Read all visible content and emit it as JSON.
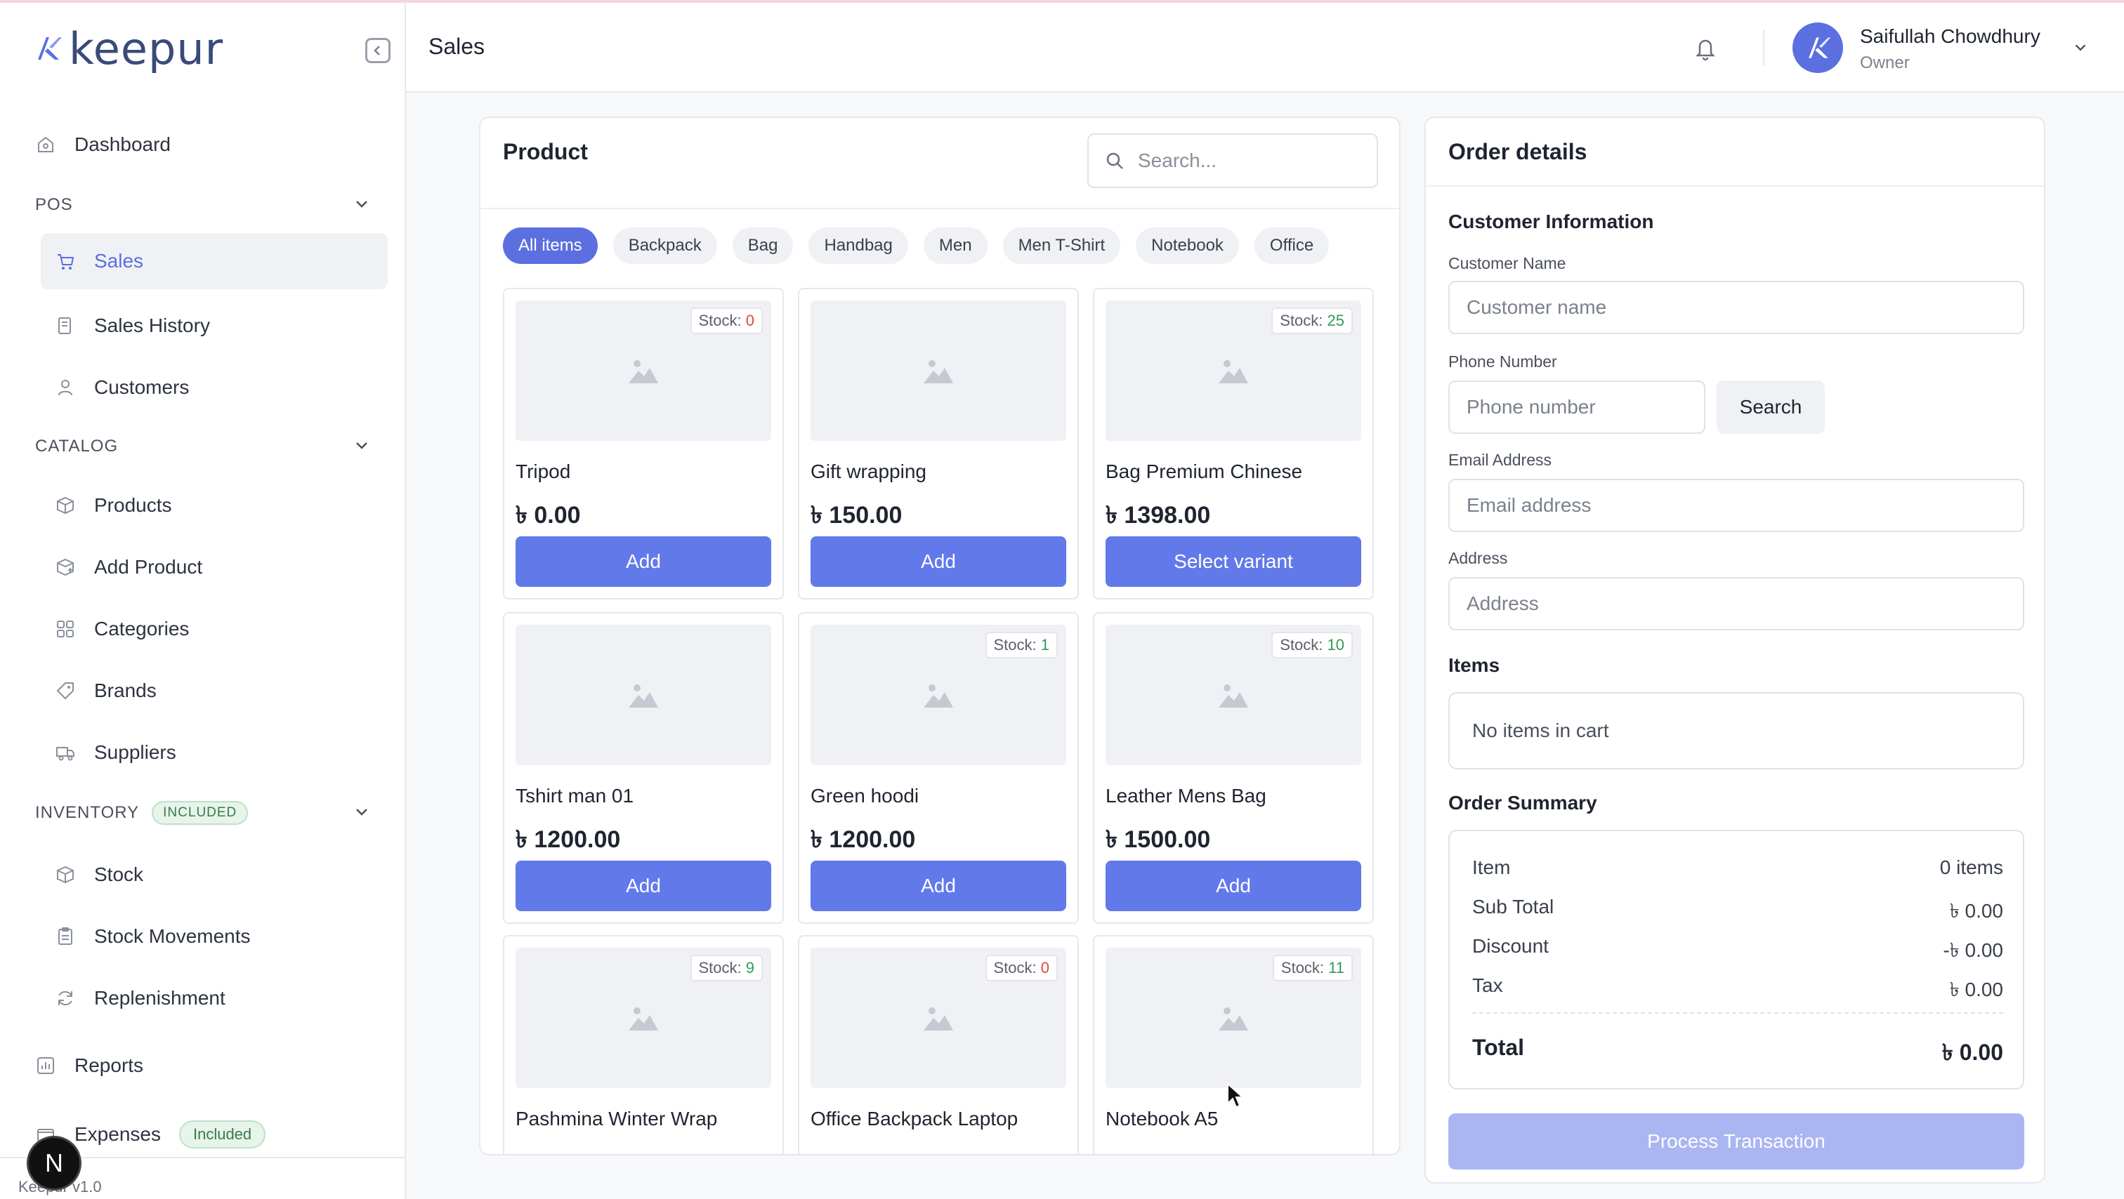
{
  "app": {
    "logo_text": "keepur",
    "version": "Keepur v1.0",
    "avatar_letter": "N"
  },
  "header": {
    "page_title": "Sales",
    "user_name": "Saifullah Chowdhury",
    "user_role": "Owner"
  },
  "sidebar": {
    "dashboard": "Dashboard",
    "pos_label": "POS",
    "sales": "Sales",
    "sales_history": "Sales History",
    "customers": "Customers",
    "catalog_label": "CATALOG",
    "products": "Products",
    "add_product": "Add Product",
    "categories": "Categories",
    "brands": "Brands",
    "suppliers": "Suppliers",
    "inventory_label": "INVENTORY",
    "inventory_badge": "INCLUDED",
    "stock": "Stock",
    "stock_movements": "Stock Movements",
    "replenishment": "Replenishment",
    "reports": "Reports",
    "expenses": "Expenses",
    "expenses_badge": "Included"
  },
  "products_panel": {
    "title": "Product",
    "search_placeholder": "Search...",
    "chips": [
      "All items",
      "Backpack",
      "Bag",
      "Handbag",
      "Men",
      "Men T-Shirt",
      "Notebook",
      "Office"
    ],
    "stock_prefix": "Stock: ",
    "cards": [
      {
        "name": "Tripod",
        "price": "৳ 0.00",
        "stock": "0",
        "button": "Add"
      },
      {
        "name": "Gift wrapping",
        "price": "৳ 150.00",
        "stock": "",
        "button": "Add"
      },
      {
        "name": "Bag Premium Chinese",
        "price": "৳ 1398.00",
        "stock": "25",
        "button": "Select variant"
      },
      {
        "name": "Tshirt man 01",
        "price": "৳ 1200.00",
        "stock": "",
        "button": "Add"
      },
      {
        "name": "Green hoodi",
        "price": "৳ 1200.00",
        "stock": "1",
        "button": "Add"
      },
      {
        "name": "Leather Mens Bag",
        "price": "৳ 1500.00",
        "stock": "10",
        "button": "Add"
      },
      {
        "name": "Pashmina Winter Wrap",
        "price": "",
        "stock": "9",
        "button": ""
      },
      {
        "name": "Office Backpack Laptop",
        "price": "",
        "stock": "0",
        "button": ""
      },
      {
        "name": "Notebook A5",
        "price": "",
        "stock": "11",
        "button": ""
      }
    ]
  },
  "order": {
    "title": "Order details",
    "customer_info": "Customer Information",
    "customer_name_label": "Customer Name",
    "customer_name_placeholder": "Customer name",
    "phone_label": "Phone Number",
    "phone_placeholder": "Phone number",
    "search_button": "Search",
    "email_label": "Email Address",
    "email_placeholder": "Email address",
    "address_label": "Address",
    "address_placeholder": "Address",
    "items_title": "Items",
    "no_items": "No items in cart",
    "summary_title": "Order Summary",
    "summary": {
      "item_label": "Item",
      "item_value": "0 items",
      "subtotal_label": "Sub Total",
      "subtotal_value": "৳ 0.00",
      "discount_label": "Discount",
      "discount_value": "-৳ 0.00",
      "tax_label": "Tax",
      "tax_value": "৳ 0.00",
      "total_label": "Total",
      "total_value": "৳ 0.00"
    },
    "process_button": "Process Transaction"
  },
  "colors": {
    "accent": "#6279ea",
    "accent_disabled": "#aab6f2",
    "stock_zero": "#e0483b",
    "stock_positive": "#2f9a5a"
  }
}
